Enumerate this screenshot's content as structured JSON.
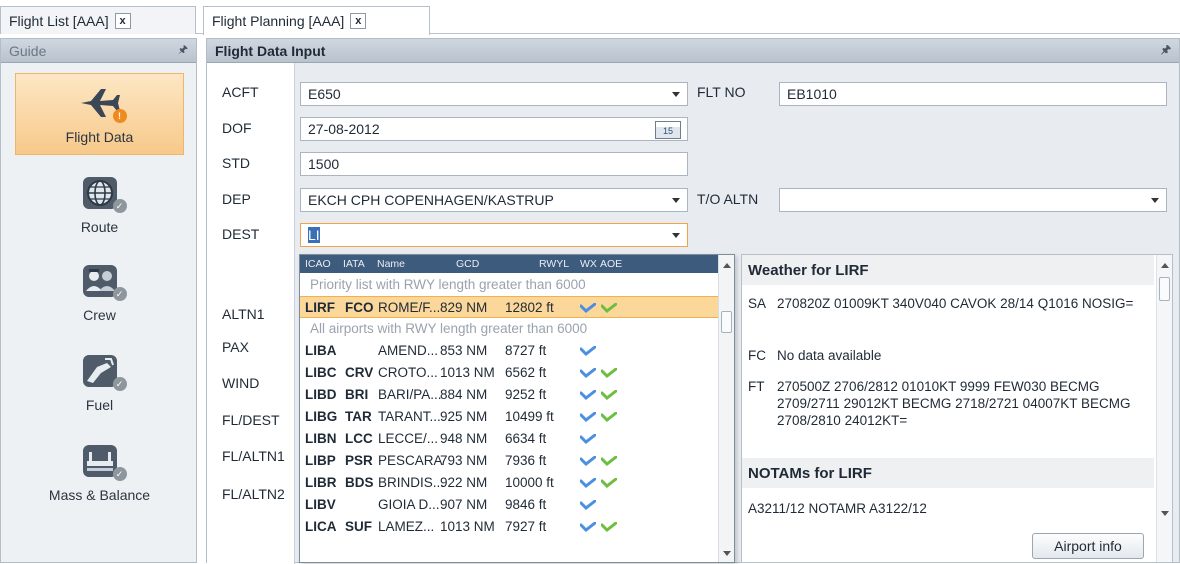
{
  "tabs": [
    {
      "label": "Flight List [AAA]",
      "close": "x"
    },
    {
      "label": "Flight Planning [AAA]",
      "close": "x"
    }
  ],
  "guide": {
    "title": "Guide",
    "items": [
      {
        "label": "Flight Data",
        "icon": "airplane-icon",
        "active": true
      },
      {
        "label": "Route",
        "icon": "globe-icon"
      },
      {
        "label": "Crew",
        "icon": "crew-icon"
      },
      {
        "label": "Fuel",
        "icon": "fuel-pump-icon"
      },
      {
        "label": "Mass & Balance",
        "icon": "scale-icon"
      }
    ]
  },
  "form": {
    "title": "Flight Data Input",
    "labels": {
      "acft": "ACFT",
      "dof": "DOF",
      "std": "STD",
      "dep": "DEP",
      "dest": "DEST",
      "altn1": "ALTN1",
      "pax": "PAX",
      "wind": "WIND",
      "fl_dest": "FL/DEST",
      "fl_altn1": "FL/ALTN1",
      "fl_altn2": "FL/ALTN2",
      "flt_no": "FLT NO",
      "to_altn": "T/O ALTN"
    },
    "values": {
      "acft": "E650",
      "flt_no": "EB1010",
      "dof": "27-08-2012",
      "calendar_day": "15",
      "std": "1500",
      "dep": "EKCH CPH COPENHAGEN/KASTRUP",
      "to_altn": "",
      "dest": "LI"
    }
  },
  "airport_list": {
    "headers": {
      "icao": "ICAO",
      "iata": "IATA",
      "name": "Name",
      "gcd": "GCD",
      "rwyl": "RWYL",
      "wx": "WX",
      "aoe": "AOE"
    },
    "sections": {
      "priority": "Priority list  with RWY length greater than 6000",
      "all": "All airports  with RWY length greater than 6000"
    },
    "rows": [
      {
        "icao": "LIRF",
        "iata": "FCO",
        "name": "ROME/F...",
        "gcd": "829 NM",
        "rwyl": "12802 ft",
        "aoe": true
      },
      {
        "icao": "LIBA",
        "iata": "",
        "name": "AMEND...",
        "gcd": "853 NM",
        "rwyl": "8727 ft",
        "aoe": false
      },
      {
        "icao": "LIBC",
        "iata": "CRV",
        "name": "CROTO...",
        "gcd": "1013 NM",
        "rwyl": "6562 ft",
        "aoe": true
      },
      {
        "icao": "LIBD",
        "iata": "BRI",
        "name": "BARI/PA...",
        "gcd": "884 NM",
        "rwyl": "9252 ft",
        "aoe": true
      },
      {
        "icao": "LIBG",
        "iata": "TAR",
        "name": "TARANT...",
        "gcd": "925 NM",
        "rwyl": "10499 ft",
        "aoe": true
      },
      {
        "icao": "LIBN",
        "iata": "LCC",
        "name": "LECCE/...",
        "gcd": "948 NM",
        "rwyl": "6634 ft",
        "aoe": false
      },
      {
        "icao": "LIBP",
        "iata": "PSR",
        "name": "PESCARA",
        "gcd": "793 NM",
        "rwyl": "7936 ft",
        "aoe": true
      },
      {
        "icao": "LIBR",
        "iata": "BDS",
        "name": "BRINDIS...",
        "gcd": "922 NM",
        "rwyl": "10000 ft",
        "aoe": true
      },
      {
        "icao": "LIBV",
        "iata": "",
        "name": "GIOIA D...",
        "gcd": "907 NM",
        "rwyl": "9846 ft",
        "aoe": false
      },
      {
        "icao": "LICA",
        "iata": "SUF",
        "name": "LAMEZ...",
        "gcd": "1013 NM",
        "rwyl": "7927 ft",
        "aoe": true
      }
    ]
  },
  "weather": {
    "title": "Weather for LIRF",
    "entries": [
      {
        "type": "SA",
        "text": "270820Z 01009KT 340V040 CAVOK 28/14 Q1016 NOSIG="
      },
      {
        "type": "FC",
        "text": "No data available"
      },
      {
        "type": "FT",
        "text": "270500Z 2706/2812 01010KT 9999 FEW030 BECMG 2709/2711 29012KT BECMG 2718/2721 04007KT BECMG 2708/2810 24012KT="
      }
    ],
    "notams_title": "NOTAMs for LIRF",
    "notam": "A3211/12 NOTAMR A3122/12",
    "airport_info_button": "Airport info"
  },
  "colors": {
    "active_nav": "#f7c98a",
    "selected_row": "#fbd79a",
    "list_header": "#3d5b7c",
    "focus_border": "#f0a347"
  }
}
